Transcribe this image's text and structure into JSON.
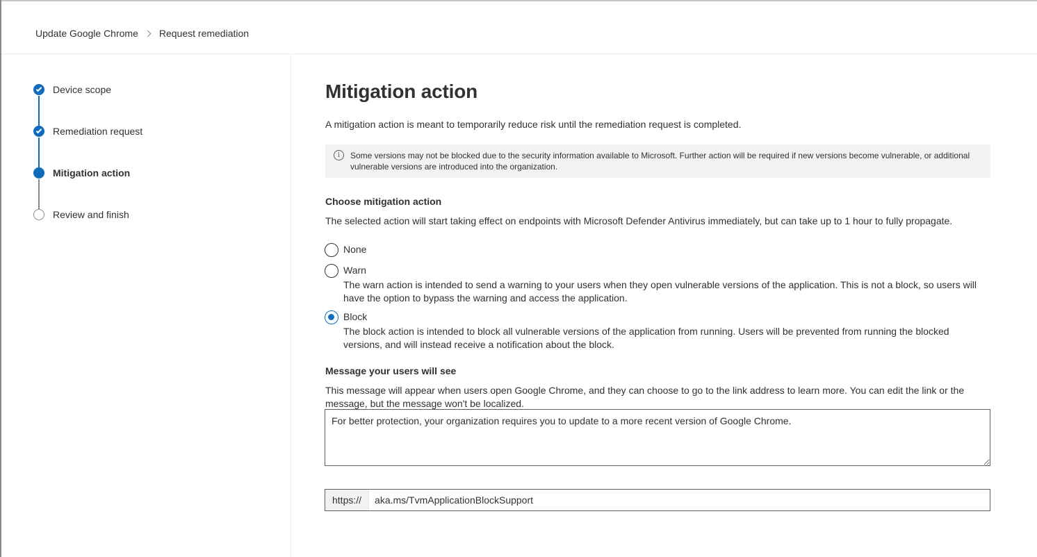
{
  "breadcrumb": {
    "items": [
      "Update Google Chrome",
      "Request remediation"
    ]
  },
  "steps": [
    {
      "label": "Device scope",
      "state": "done"
    },
    {
      "label": "Remediation request",
      "state": "done"
    },
    {
      "label": "Mitigation action",
      "state": "current"
    },
    {
      "label": "Review and finish",
      "state": "todo"
    }
  ],
  "main": {
    "title": "Mitigation action",
    "intro": "A mitigation action is meant to temporarily reduce risk until the remediation request is completed.",
    "info": "Some versions may not be blocked due to the security information available to Microsoft. Further action will be required if new versions become vulnerable, or additional vulnerable versions are introduced into the organization.",
    "choose_title": "Choose mitigation action",
    "choose_desc": "The selected action will start taking effect on endpoints with Microsoft Defender Antivirus immediately, but can take up to 1 hour to fully propagate.",
    "options": [
      {
        "label": "None",
        "desc": "",
        "checked": false
      },
      {
        "label": "Warn",
        "desc": "The warn action is intended to send a warning to your users when they open vulnerable versions of the application. This is not a block, so users will have the option to bypass the warning and access the application.",
        "checked": false
      },
      {
        "label": "Block",
        "desc": "The block action is intended to block all vulnerable versions of the application from running. Users will be prevented from running the blocked versions, and will instead receive a notification about the block.",
        "checked": true
      }
    ],
    "message_title": "Message your users will see",
    "message_desc": "This message will appear when users open Google Chrome, and they can choose to go to the link address to learn more. You can edit the link or the message, but the message won't be localized.",
    "message_value": "For better protection, your organization requires you to update to a more recent version of Google Chrome.",
    "url_prefix": "https://",
    "url_value": "aka.ms/TvmApplicationBlockSupport"
  },
  "colors": {
    "accent": "#0f6cbd",
    "info_bg": "#f3f2f1"
  }
}
